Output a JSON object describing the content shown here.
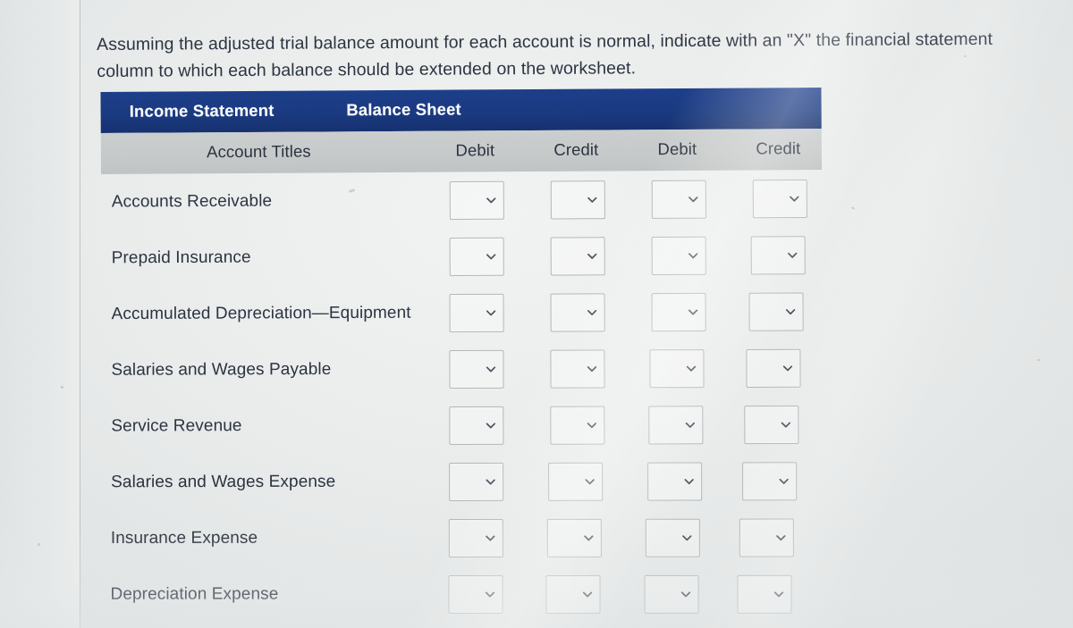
{
  "prompt": {
    "text": "Assuming the adjusted trial balance amount for each account is normal, indicate with an \"X\" the financial statement column to which each balance should be extended on the worksheet."
  },
  "worksheet": {
    "group_headers": [
      {
        "label": "Income Statement"
      },
      {
        "label": "Balance Sheet"
      }
    ],
    "column_headers": {
      "account_titles": "Account Titles",
      "income_debit": "Debit",
      "income_credit": "Credit",
      "balance_debit": "Debit",
      "balance_credit": "Credit"
    },
    "rows": [
      {
        "label": "Accounts Receivable",
        "income_debit": "",
        "income_credit": "",
        "balance_debit": "",
        "balance_credit": ""
      },
      {
        "label": "Prepaid Insurance",
        "income_debit": "",
        "income_credit": "",
        "balance_debit": "",
        "balance_credit": ""
      },
      {
        "label": "Accumulated Depreciation—Equipment",
        "income_debit": "",
        "income_credit": "",
        "balance_debit": "",
        "balance_credit": ""
      },
      {
        "label": "Salaries and Wages Payable",
        "income_debit": "",
        "income_credit": "",
        "balance_debit": "",
        "balance_credit": ""
      },
      {
        "label": "Service Revenue",
        "income_debit": "",
        "income_credit": "",
        "balance_debit": "",
        "balance_credit": ""
      },
      {
        "label": "Salaries and Wages Expense",
        "income_debit": "",
        "income_credit": "",
        "balance_debit": "",
        "balance_credit": ""
      },
      {
        "label": "Insurance Expense",
        "income_debit": "",
        "income_credit": "",
        "balance_debit": "",
        "balance_credit": ""
      },
      {
        "label": "Depreciation Expense",
        "income_debit": "",
        "income_credit": "",
        "balance_debit": "",
        "balance_credit": ""
      }
    ],
    "dropdown_icon": "chevron-down-icon"
  },
  "colors": {
    "header_blue": "#1a3a82",
    "subheader_gray": "#c8cbcb",
    "page_background": "#ecefef",
    "text_dark": "#2b3440",
    "field_border": "#b3b9ba"
  }
}
